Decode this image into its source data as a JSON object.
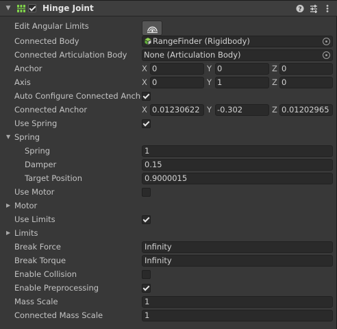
{
  "component": {
    "title": "Hinge Joint",
    "enabled": true,
    "expanded": true,
    "icons": [
      "hinge-joint-icon",
      "help-icon",
      "presets-icon",
      "more-options-icon"
    ]
  },
  "axis_labels": {
    "x": "X",
    "y": "Y",
    "z": "Z"
  },
  "rows": {
    "edit_angular_limits": {
      "label": "Edit Angular Limits",
      "icon": "angular-limits-edit-icon"
    },
    "connected_body": {
      "label": "Connected Body",
      "value": "RangeFinder (Rigidbody)",
      "icon": "rigidbody-icon"
    },
    "connected_articulation_body": {
      "label": "Connected Articulation Body",
      "value": "None (Articulation Body)"
    },
    "anchor": {
      "label": "Anchor",
      "x": "0",
      "y": "0",
      "z": "0"
    },
    "axis": {
      "label": "Axis",
      "x": "0",
      "y": "1",
      "z": "0"
    },
    "auto_configure": {
      "label": "Auto Configure Connected Anchor",
      "checked": true
    },
    "connected_anchor": {
      "label": "Connected Anchor",
      "x": "0.01230622",
      "y": "-0.302",
      "z": "0.01202965"
    },
    "use_spring": {
      "label": "Use Spring",
      "checked": true
    },
    "spring_section": {
      "label": "Spring",
      "expanded": true
    },
    "spring": {
      "label": "Spring",
      "value": "1"
    },
    "damper": {
      "label": "Damper",
      "value": "0.15"
    },
    "target_position": {
      "label": "Target Position",
      "value": "0.9000015"
    },
    "use_motor": {
      "label": "Use Motor",
      "checked": false
    },
    "motor_section": {
      "label": "Motor",
      "expanded": false
    },
    "use_limits": {
      "label": "Use Limits",
      "checked": true
    },
    "limits_section": {
      "label": "Limits",
      "expanded": false
    },
    "break_force": {
      "label": "Break Force",
      "value": "Infinity"
    },
    "break_torque": {
      "label": "Break Torque",
      "value": "Infinity"
    },
    "enable_collision": {
      "label": "Enable Collision",
      "checked": false
    },
    "enable_preprocessing": {
      "label": "Enable Preprocessing",
      "checked": true
    },
    "mass_scale": {
      "label": "Mass Scale",
      "value": "1"
    },
    "connected_mass_scale": {
      "label": "Connected Mass Scale",
      "value": "1"
    }
  },
  "colors": {
    "background": "#383838",
    "header": "#3e3e3e",
    "field": "#2a2a2a",
    "icon_green": "#7fd04a",
    "text": "#c4c4c4"
  }
}
